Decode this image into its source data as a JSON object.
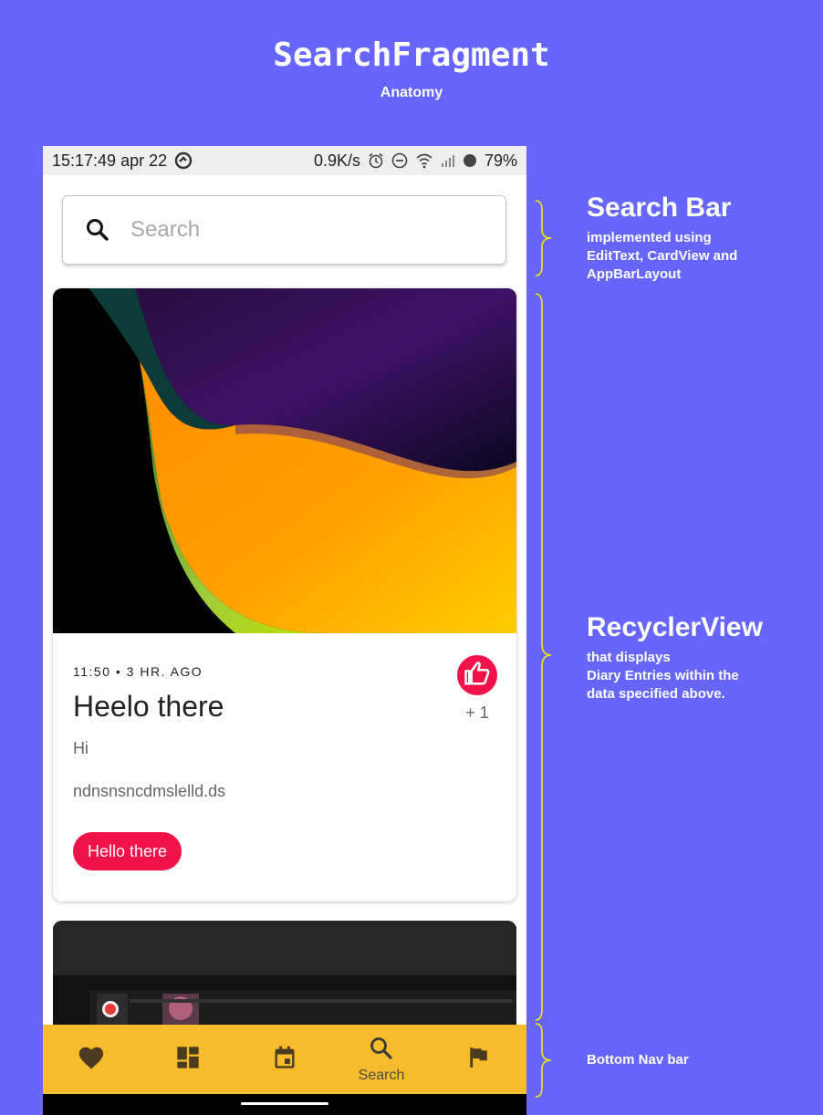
{
  "header": {
    "title": "SearchFragment",
    "subtitle": "Anatomy"
  },
  "status_bar": {
    "time": "15:17:49 apr 22",
    "speed": "0.9K/s",
    "battery": "79%"
  },
  "search": {
    "placeholder": "Search"
  },
  "cards": [
    {
      "meta": "11:50 • 3 HR. AGO",
      "title": "Heelo there",
      "body": "Hi",
      "body2": "ndnsnsncdmslelld.ds",
      "likes": "+ 1",
      "chip": "Hello there"
    }
  ],
  "bottom_nav": {
    "items": [
      {
        "icon": "heart-icon",
        "label": ""
      },
      {
        "icon": "dashboard-icon",
        "label": ""
      },
      {
        "icon": "calendar-icon",
        "label": ""
      },
      {
        "icon": "search-icon",
        "label": "Search"
      },
      {
        "icon": "flag-icon",
        "label": ""
      }
    ]
  },
  "annotations": {
    "search_bar": {
      "heading": "Search Bar",
      "text": [
        "implemented using",
        "EditText, CardView and",
        "AppBarLayout"
      ]
    },
    "recycler": {
      "heading": "RecyclerView",
      "text": [
        "that displays",
        "Diary Entries within the",
        "data specified above."
      ]
    },
    "bottom_nav": {
      "heading": "Bottom Nav bar"
    }
  },
  "colors": {
    "background": "#6666ff",
    "accent": "#f2124a",
    "nav": "#f6bc2b",
    "brace": "#f5e60a"
  }
}
